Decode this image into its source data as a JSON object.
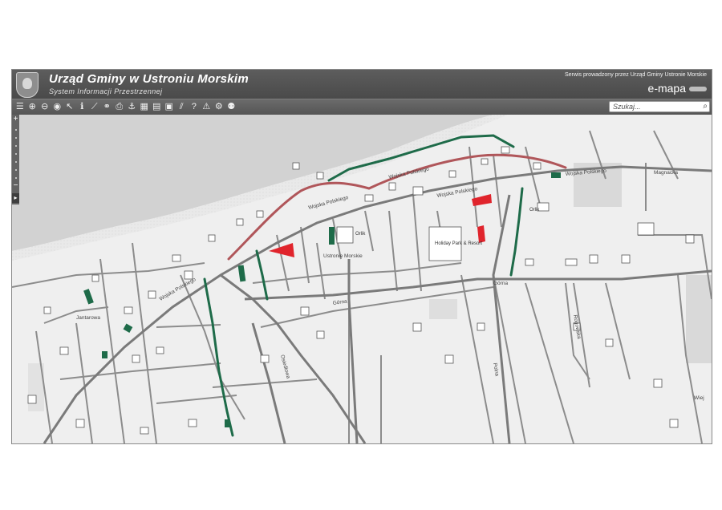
{
  "header": {
    "title": "Urząd Gminy w Ustroniu Morskim",
    "subtitle": "System Informacji Przestrzennej",
    "service_note": "Serwis prowadzony przez Urząd Gminy Ustronie Morskie",
    "brand": "e-mapa"
  },
  "toolbar": {
    "tools": [
      {
        "name": "layers-icon",
        "glyph": "☰"
      },
      {
        "name": "zoom-in-icon",
        "glyph": "⊕"
      },
      {
        "name": "zoom-out-icon",
        "glyph": "⊖"
      },
      {
        "name": "full-extent-icon",
        "glyph": "◉"
      },
      {
        "name": "pointer-icon",
        "glyph": "↖"
      },
      {
        "name": "info-icon",
        "glyph": "ℹ"
      },
      {
        "name": "measure-line-icon",
        "glyph": "⟋"
      },
      {
        "name": "link-icon",
        "glyph": "⚭"
      },
      {
        "name": "print-icon",
        "glyph": "⎙"
      },
      {
        "name": "anchor-icon",
        "glyph": "⚓"
      },
      {
        "name": "grid-icon",
        "glyph": "▦"
      },
      {
        "name": "layout-icon",
        "glyph": "▤"
      },
      {
        "name": "table-icon",
        "glyph": "▣"
      },
      {
        "name": "hatch-icon",
        "glyph": "⫽"
      },
      {
        "name": "help-icon",
        "glyph": "?"
      },
      {
        "name": "warning-icon",
        "glyph": "⚠"
      },
      {
        "name": "settings-icon",
        "glyph": "⚙"
      },
      {
        "name": "users-icon",
        "glyph": "⚉"
      }
    ]
  },
  "search": {
    "placeholder": "Szukaj..."
  },
  "map": {
    "expand_glyph": "▸",
    "street_labels": [
      "Wojska Polskiego",
      "Wojska Polskiego",
      "Wojska Polskiego",
      "Wojska Polskiego",
      "Wojska Polskiego",
      "Magnacka",
      "Górna",
      "Górna",
      "Polna",
      "Osiedlowa",
      "Rogowska",
      "Jantarowa",
      "Ustronie Morskie",
      "Wiej"
    ],
    "poi_labels": [
      "Orlik",
      "Orlik",
      "Holiday Park & Resort"
    ]
  },
  "colors": {
    "road_main": "#b0565a",
    "road_green": "#1e6b49",
    "marker_red": "#e0242c",
    "marker_green": "#1e6b49",
    "sea": "#d4d4d4",
    "land": "#efefef"
  }
}
